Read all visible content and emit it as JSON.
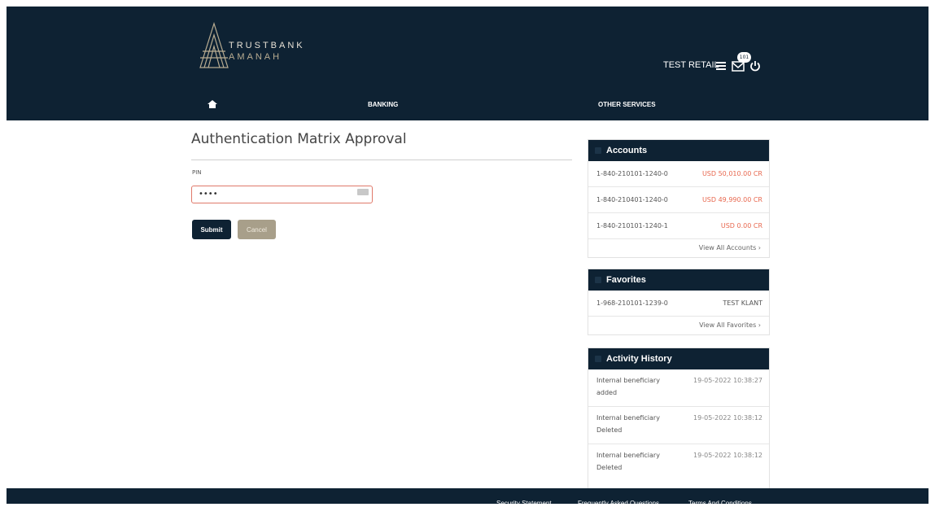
{
  "brand": {
    "line1": "TRUSTBANK",
    "line2": "AMANAH"
  },
  "header": {
    "user_name": "TEST RETAIL",
    "mail_badge": "101"
  },
  "nav": {
    "banking": "BANKING",
    "other_services": "OTHER SERVICES"
  },
  "page": {
    "title": "Authentication Matrix Approval",
    "pin_label": "PIN",
    "pin_value": "••••",
    "submit_label": "Submit",
    "cancel_label": "Cancel"
  },
  "accounts": {
    "title": "Accounts",
    "rows": [
      {
        "account": "1-840-210101-1240-0",
        "balance": "USD 50,010.00 CR"
      },
      {
        "account": "1-840-210401-1240-0",
        "balance": "USD 49,990.00 CR"
      },
      {
        "account": "1-840-210101-1240-1",
        "balance": "USD 0.00 CR"
      }
    ],
    "view_all": "View All Accounts ›"
  },
  "favorites": {
    "title": "Favorites",
    "rows": [
      {
        "account": "1-968-210101-1239-0",
        "name": "TEST KLANT"
      }
    ],
    "view_all": "View All Favorites ›"
  },
  "activity": {
    "title": "Activity History",
    "rows": [
      {
        "line1": "Internal beneficiary",
        "line2": "added",
        "time": "19-05-2022 10:38:27"
      },
      {
        "line1": "Internal beneficiary",
        "line2": "Deleted",
        "time": "19-05-2022 10:38:12"
      },
      {
        "line1": "Internal beneficiary",
        "line2": "Deleted",
        "time": "19-05-2022 10:38:12"
      }
    ]
  },
  "footer": {
    "security": "Security Statement",
    "faq": "Frequently Asked Questions",
    "terms": "Terms And Conditions"
  },
  "colors": {
    "navy": "#0e2233",
    "negative": "#e8684f",
    "cancel": "#a89f8a"
  }
}
